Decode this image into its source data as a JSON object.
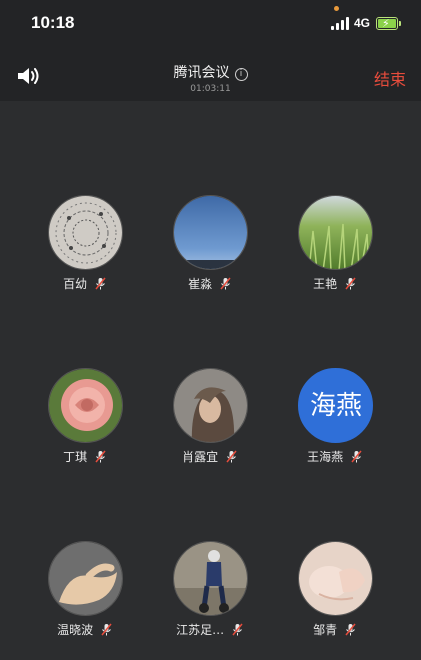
{
  "status_bar": {
    "time": "10:18",
    "network": "4G"
  },
  "header": {
    "title": "腾讯会议",
    "duration": "01:03:11",
    "end_label": "结束"
  },
  "participants": [
    {
      "name": "百幼"
    },
    {
      "name": "崔淼"
    },
    {
      "name": "王艳"
    },
    {
      "name": "丁琪"
    },
    {
      "name": "肖露宜"
    },
    {
      "name": "王海燕",
      "avatar_text": "海燕"
    },
    {
      "name": "温晓波"
    },
    {
      "name": "江苏足…"
    },
    {
      "name": "邹青"
    }
  ],
  "colors": {
    "end": "#e74c3c",
    "avatar_blue": "#2f6fd8"
  }
}
